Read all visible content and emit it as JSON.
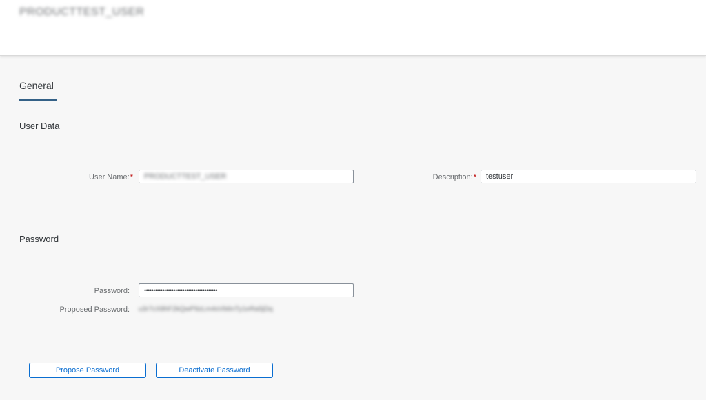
{
  "header": {
    "title": "PRODUCTTEST_USER"
  },
  "tabs": [
    {
      "label": "General"
    }
  ],
  "user_data": {
    "section_title": "User Data",
    "user_name_label": "User Name:",
    "user_name_value": "PRODUCTTEST_USER",
    "description_label": "Description:",
    "description_value": "testuser",
    "required_marker": "*"
  },
  "password": {
    "section_title": "Password",
    "password_label": "Password:",
    "password_value": "••••••••••••••••••••••••••••••••••••••••",
    "proposed_label": "Proposed Password:",
    "proposed_value": "u3r7cX8hF2kQwP9zLm4sVb6nTy1eRa5jDq"
  },
  "buttons": {
    "propose": "Propose Password",
    "deactivate": "Deactivate Password"
  },
  "colors": {
    "accent": "#0a6ed1",
    "tab_underline": "#346187",
    "required": "#bb0000",
    "background": "#f7f7f7"
  }
}
